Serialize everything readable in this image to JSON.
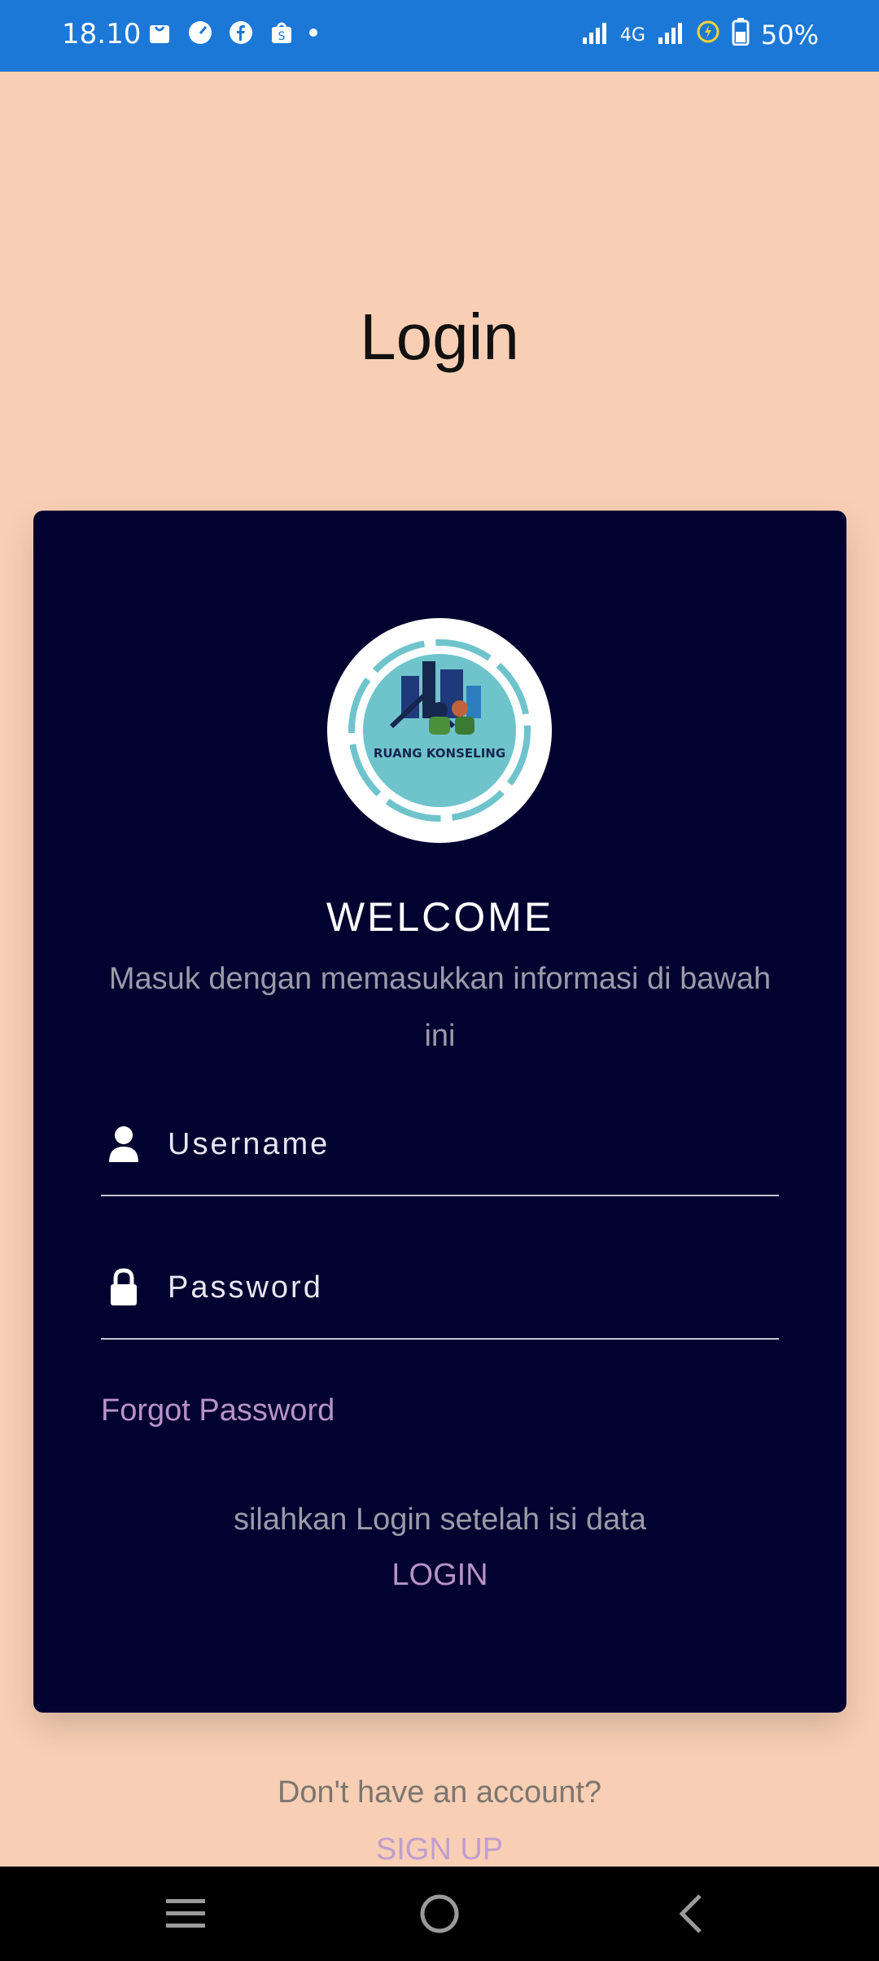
{
  "status_bar": {
    "time": "18.10",
    "network": "4G",
    "battery": "50%",
    "left_icons": [
      "shopping-bag-icon",
      "speedometer-icon",
      "facebook-icon",
      "shop-icon",
      "notification-dot"
    ],
    "right_icons": [
      "signal-icon",
      "4g-icon",
      "signal-icon-2",
      "battery-saver-icon",
      "battery-icon"
    ]
  },
  "page": {
    "title": "Login"
  },
  "card": {
    "logo_text": "RUANG KONSELING",
    "welcome": "WELCOME",
    "subtitle": "Masuk dengan memasukkan informasi di bawah ini",
    "username": {
      "placeholder": "Username",
      "value": "",
      "icon": "user-icon"
    },
    "password": {
      "placeholder": "Password",
      "value": "",
      "icon": "lock-icon"
    },
    "forgot": "Forgot Password",
    "hint": "silahkan Login setelah isi data",
    "login": "LOGIN"
  },
  "footer": {
    "no_account": "Don't have an account?",
    "signup": "SIGN UP"
  },
  "nav": {
    "items": [
      "menu-icon",
      "home-icon",
      "back-icon"
    ]
  },
  "colors": {
    "background": "#f8cfb4",
    "status_bar": "#1c78d6",
    "card": "#020230",
    "accent": "#b892c8",
    "muted": "#9b9aa8"
  }
}
